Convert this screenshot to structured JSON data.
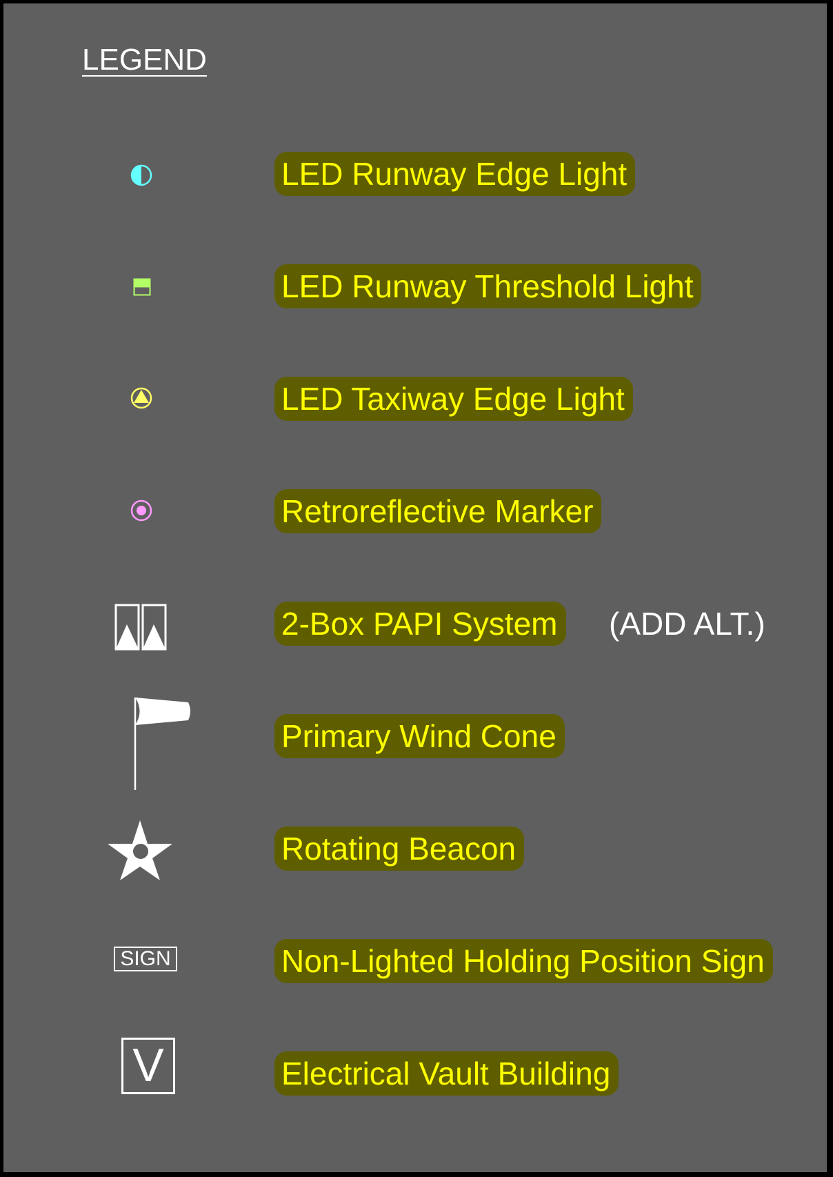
{
  "legend": {
    "title": "LEGEND",
    "items": [
      {
        "symbol": "led-runway-edge-light-icon",
        "label": "LED Runway Edge Light",
        "color": "#66ffff"
      },
      {
        "symbol": "led-runway-threshold-light-icon",
        "label": "LED Runway Threshold Light",
        "color": "#b3ff66"
      },
      {
        "symbol": "led-taxiway-edge-light-icon",
        "label": "LED Taxiway Edge Light",
        "color": "#ffff66"
      },
      {
        "symbol": "retroreflective-marker-icon",
        "label": "Retroreflective Marker",
        "color": "#ff99ff"
      },
      {
        "symbol": "papi-icon",
        "label": "2-Box PAPI System",
        "note": "(ADD ALT.)",
        "color": "#ffffff"
      },
      {
        "symbol": "wind-cone-icon",
        "label": "Primary Wind Cone",
        "color": "#ffffff"
      },
      {
        "symbol": "rotating-beacon-icon",
        "label": "Rotating Beacon",
        "color": "#ffffff"
      },
      {
        "symbol": "sign-icon",
        "symbol_text": "SIGN",
        "label": "Non-Lighted Holding Position Sign",
        "color": "#ffffff"
      },
      {
        "symbol": "vault-icon",
        "symbol_text": "V",
        "label": "Electrical Vault Building",
        "color": "#ffffff"
      }
    ]
  },
  "colors": {
    "background": "#5f5f5f",
    "label_text": "#ffff00",
    "label_highlight": "#5e5e00",
    "note_text": "#ffffff"
  }
}
